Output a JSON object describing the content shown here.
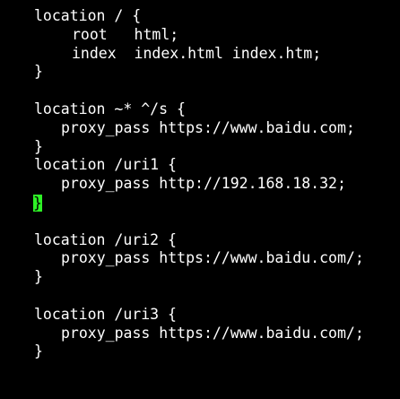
{
  "theme": {
    "background": "#000000",
    "foreground": "#ffffff",
    "cursor_color": "#2ef226"
  },
  "editor": {
    "lines": [
      "location / {",
      "root   html;",
      "index  index.html index.htm;",
      "}",
      "",
      "location ~* ^/s {",
      "proxy_pass https://www.baidu.com;",
      "}",
      "location /uri1 {",
      "proxy_pass http://192.168.18.32;",
      "}",
      "",
      "location /uri2 {",
      "proxy_pass https://www.baidu.com/;",
      "}",
      "",
      "location /uri3 {",
      "proxy_pass https://www.baidu.com/;",
      "}"
    ],
    "cursor_char": "}"
  }
}
